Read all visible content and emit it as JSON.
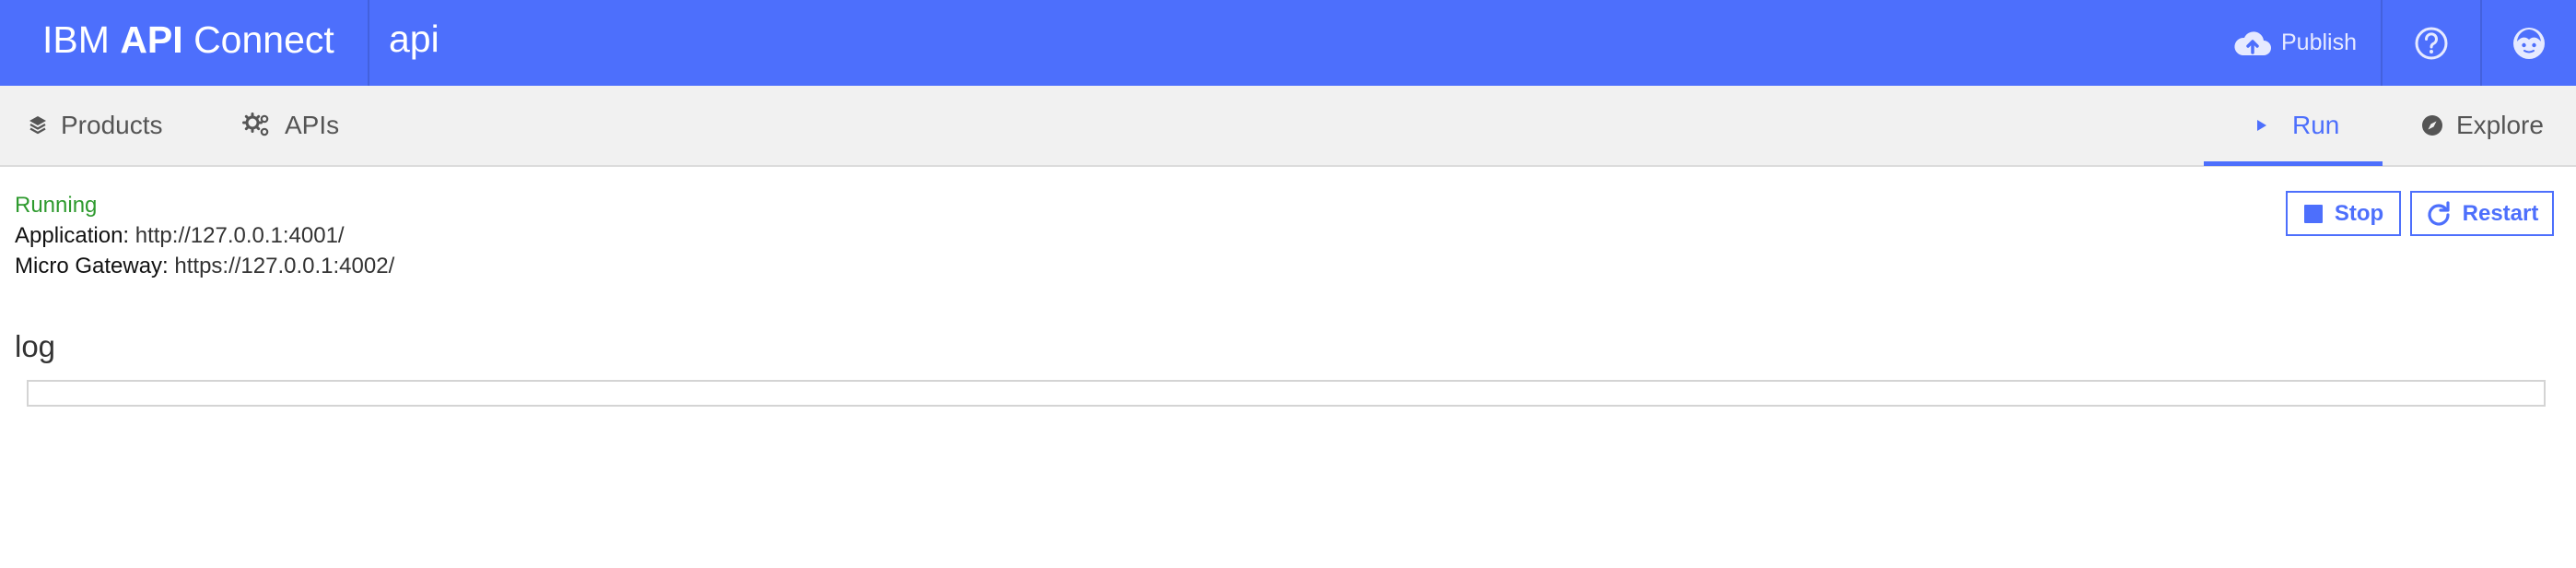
{
  "header": {
    "brand_prefix": "IBM",
    "brand_strong": "API",
    "brand_suffix": "Connect",
    "app_name": "api",
    "publish_label": "Publish",
    "publish_icon": "cloud-upload-icon",
    "help_icon": "help-icon",
    "user_icon": "user-avatar-icon",
    "accent_color": "#4d6ffc"
  },
  "nav": {
    "products_label": "Products",
    "products_icon": "layers-icon",
    "apis_label": "APIs",
    "apis_icon": "gears-icon",
    "run_label": "Run",
    "run_icon": "play-icon",
    "explore_label": "Explore",
    "explore_icon": "compass-icon",
    "active_tab": "Run"
  },
  "run": {
    "status": "Running",
    "status_color": "#2e9a2e",
    "application_label": "Application:",
    "application_url": "http://127.0.0.1:4001/",
    "gateway_label": "Micro Gateway:",
    "gateway_url": "https://127.0.0.1:4002/",
    "stop_label": "Stop",
    "stop_icon": "stop-icon",
    "restart_label": "Restart",
    "restart_icon": "restart-icon"
  },
  "log": {
    "heading": "log",
    "content": ""
  }
}
